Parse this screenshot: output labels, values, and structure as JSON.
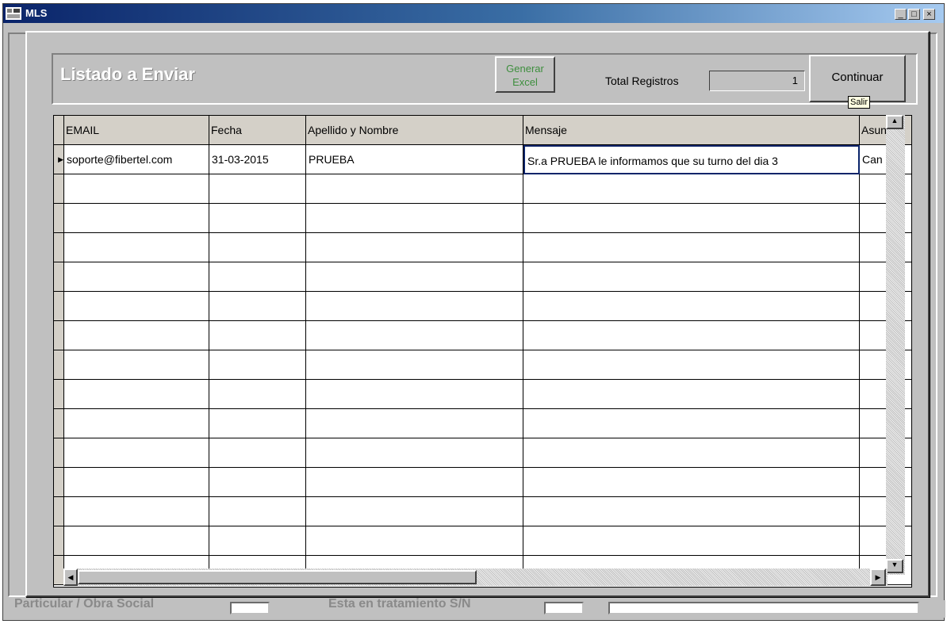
{
  "window": {
    "title": "MLS",
    "controls": [
      "_",
      "□",
      "×"
    ]
  },
  "background_form": {
    "label_particular": "Particular / Obra Social",
    "label_tratamiento": "Esta en tratamiento S/N"
  },
  "dialog": {
    "title": "Listado a Enviar",
    "generar_label": "Generar Excel",
    "total_label": "Total Registros",
    "total_value": "1",
    "continuar_label": "Continuar",
    "tooltip": "Salir"
  },
  "grid": {
    "columns": [
      "EMAIL",
      "Fecha",
      "Apellido y Nombre",
      "Mensaje",
      "Asun"
    ],
    "rows": [
      {
        "email": "soporte@fibertel.com",
        "fecha": "31-03-2015",
        "nombre": "PRUEBA",
        "mensaje": "Sr.a PRUEBA le informamos que su turno del dia 3",
        "asunto": "Can"
      }
    ],
    "current_row_indicator": "▶"
  }
}
